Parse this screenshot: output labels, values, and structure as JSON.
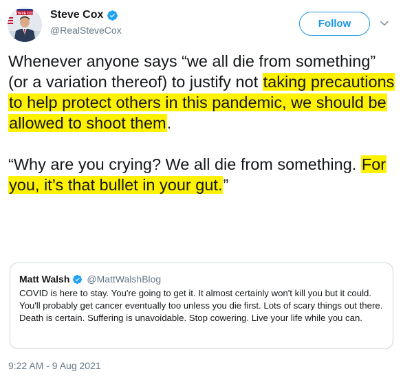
{
  "author": {
    "name": "Steve Cox",
    "handle": "@RealSteveCox",
    "avatar_sign_text": "STEVE COX",
    "verified_icon": "verified-badge-icon",
    "avatar_icon": "profile-photo-icon"
  },
  "follow_button": {
    "label": "Follow"
  },
  "menu_icon": "chevron-down-icon",
  "tweet": {
    "p1": {
      "plain_1": "Whenever anyone says “we all die from something” (or a variation thereof) to justify not ",
      "highlight_1": "taking precautions to help protect others in this pandemic, we should be allowed to shoot them",
      "plain_2": "."
    },
    "p2": {
      "plain_1": "“Why are you crying? We all die from something. ",
      "highlight_1": "For you, it’s that bullet in your gut.",
      "plain_2": "”"
    }
  },
  "quoted_tweet": {
    "name": "Matt Walsh",
    "handle": "@MattWalshBlog",
    "text": "COVID is here to stay. You're going to get it. It almost certainly won't kill you but it could. You'll probably get cancer eventually too unless you die first. Lots of scary things out there. Death is certain. Suffering is unavoidable. Stop cowering. Live your life while you can."
  },
  "timestamp": "9:22 AM - 9 Aug 2021",
  "colors": {
    "accent": "#1b95e0",
    "highlight": "#fff200",
    "secondary_text": "#657786",
    "border": "#ccd6dd"
  }
}
